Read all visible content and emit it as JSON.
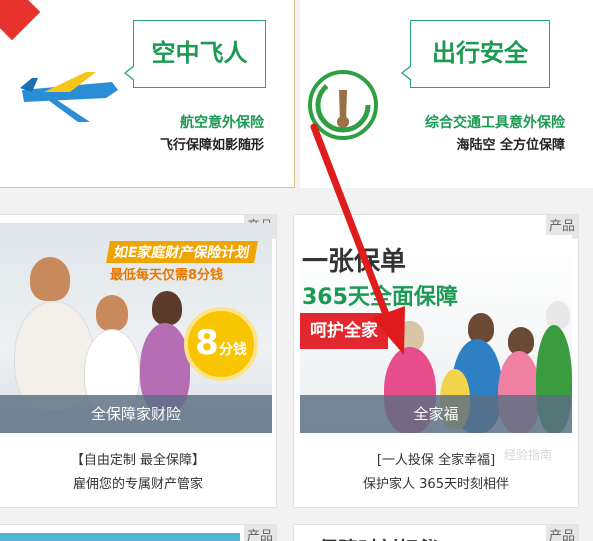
{
  "tiles": [
    {
      "badge": "空中飞人",
      "subtitle": "航空意外保险",
      "slogan": "飞行保障如影随形",
      "icon": "airplane-icon"
    },
    {
      "badge": "出行安全",
      "subtitle": "综合交通工具意外保险",
      "slogan": "海陆空 全方位保障",
      "icon": "gauge-icon"
    }
  ],
  "products": [
    {
      "tag": "产品",
      "promo_title": "如E家庭财产保险计划",
      "promo_sub": "最低每天仅需8分钱",
      "badge_num": "8",
      "badge_unit": "分钱",
      "banner": "全保障家财险",
      "line1": "【自由定制 最全保障】",
      "line2": "雇佣您的专属财产管家"
    },
    {
      "tag": "产品",
      "headline1": "一张保单",
      "headline2": "365天全面保障",
      "button": "呵护全家",
      "banner": "全家福",
      "line1": "[一人投保 全家幸福]",
      "line2": "保护家人 365天时刻相伴"
    }
  ],
  "bottom_tags": [
    "产品",
    "产品"
  ],
  "bottom_partial_text": "保障时刻相伴",
  "watermark": "经验指南",
  "colors": {
    "brand_green": "#1a9a52",
    "accent_red": "#e2282e",
    "banner_blue": "#5a6e82",
    "badge_yellow": "#f7c600"
  }
}
